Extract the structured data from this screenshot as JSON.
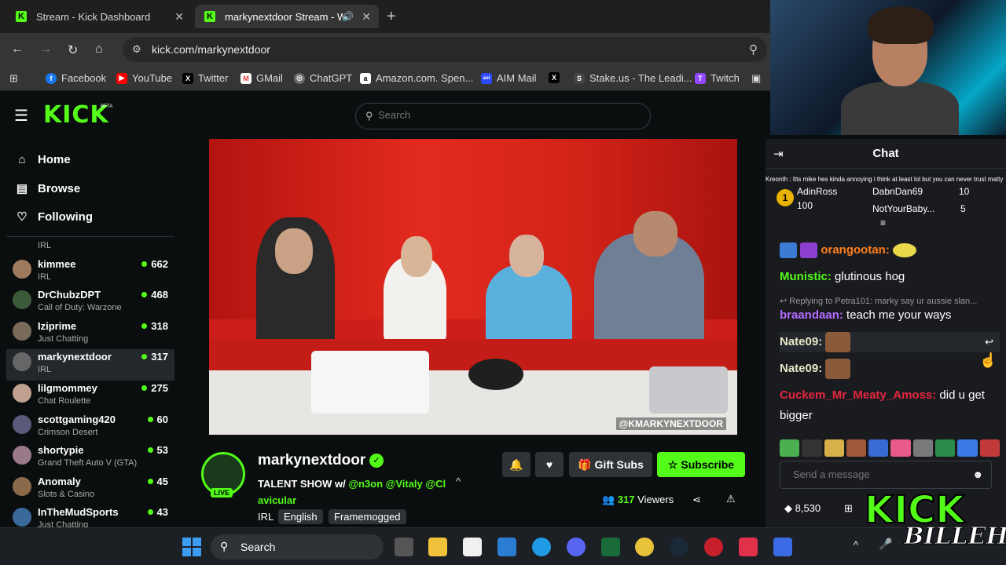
{
  "browser": {
    "tabs": [
      {
        "label": "Stream - Kick Dashboard"
      },
      {
        "label": "markynextdoor Stream - W"
      }
    ],
    "url": "kick.com/markynextdoor",
    "bookmarks": [
      {
        "label": "Facebook",
        "icon": "facebook-icon",
        "color": "#1877f2"
      },
      {
        "label": "YouTube",
        "icon": "youtube-icon",
        "color": "#ff0000"
      },
      {
        "label": "Twitter",
        "icon": "x-icon",
        "color": "#000000"
      },
      {
        "label": "GMail",
        "icon": "gmail-icon",
        "color": "#ea4335"
      },
      {
        "label": "ChatGPT",
        "icon": "chatgpt-icon",
        "color": "#6b6b6b"
      },
      {
        "label": "Amazon.com. Spen...",
        "icon": "amazon-icon",
        "color": "#ff9900"
      },
      {
        "label": "AIM Mail",
        "icon": "aol-icon",
        "color": "#2c4bff"
      },
      {
        "label": "",
        "icon": "x-icon",
        "color": "#000000"
      },
      {
        "label": "Stake.us - The Leadi...",
        "icon": "stake-icon",
        "color": "#444444"
      },
      {
        "label": "Twitch",
        "icon": "twitch-icon",
        "color": "#9146ff"
      }
    ]
  },
  "kick": {
    "logo": "KICK",
    "beta": "BETA",
    "search_placeholder": "Search",
    "accent": "#53fc18"
  },
  "sidebar": {
    "nav": [
      {
        "label": "Home",
        "icon": "home-icon"
      },
      {
        "label": "Browse",
        "icon": "browse-icon"
      },
      {
        "label": "Following",
        "icon": "heart-icon"
      }
    ],
    "channels": [
      {
        "name": "",
        "category": "IRL",
        "viewers": ""
      },
      {
        "name": "kimmee",
        "category": "IRL",
        "viewers": "662"
      },
      {
        "name": "DrChubzDPT",
        "category": "Call of Duty: Warzone",
        "viewers": "468"
      },
      {
        "name": "Iziprime",
        "category": "Just Chatting",
        "viewers": "318"
      },
      {
        "name": "markynextdoor",
        "category": "IRL",
        "viewers": "317"
      },
      {
        "name": "lilgmommey",
        "category": "Chat Roulette",
        "viewers": "275"
      },
      {
        "name": "scottgaming420",
        "category": "Crimson Desert",
        "viewers": "60"
      },
      {
        "name": "shortypie",
        "category": "Grand Theft Auto V (GTA)",
        "viewers": "53"
      },
      {
        "name": "Anomaly",
        "category": "Slots & Casino",
        "viewers": "45"
      },
      {
        "name": "InTheMudSports",
        "category": "Just Chatting",
        "viewers": "43"
      }
    ]
  },
  "video": {
    "watermark": "@KMARKYNEXTDOOR"
  },
  "stream": {
    "streamer": "markynextdoor",
    "live": "LIVE",
    "title_prefix": "TALENT SHOW w/ ",
    "title_mentions": "@n3on @Vitaly @Cl",
    "title_line2": "avicular",
    "tags": [
      "IRL",
      "English",
      "Framemogged"
    ],
    "gift_subs": "Gift Subs",
    "subscribe": "Subscribe",
    "viewers_count": "317",
    "viewers_label": "Viewers"
  },
  "chat": {
    "title": "Chat",
    "pinned_message": "Kreonth : Itts mike hes kinda annoying i think at least lol but you can never trust matty",
    "gifters": [
      {
        "name": "AdinRoss",
        "count": "100",
        "rank": "1"
      },
      {
        "name": "DabnDan69",
        "count": "10"
      },
      {
        "name": "NotYourBaby...",
        "count": "5"
      }
    ],
    "messages": [
      {
        "user": "orangootan:",
        "text": "",
        "color": "#ff7f1f"
      },
      {
        "user": "Munistic:",
        "text": "glutinous hog",
        "color": "#53fc18"
      },
      {
        "reply": "Replying to Petra101: marky say ur aussie slan..."
      },
      {
        "user": "braandaan:",
        "text": "teach me your ways",
        "color": "#b36cff"
      },
      {
        "user": "Nate09:",
        "text": "",
        "color": "#e8e8c8"
      },
      {
        "user": "Nate09:",
        "text": "",
        "color": "#e8e8c8"
      },
      {
        "user": "Cuckem_Mr_Meaty_Amoss:",
        "text": "did u get bigger",
        "color": "#e6263e"
      }
    ],
    "input_placeholder": "Send a message",
    "points": "8,530"
  },
  "taskbar": {
    "search_label": "Search"
  },
  "overlay": {
    "logo_top": "KICK",
    "logo_bottom": "BILLEH"
  }
}
